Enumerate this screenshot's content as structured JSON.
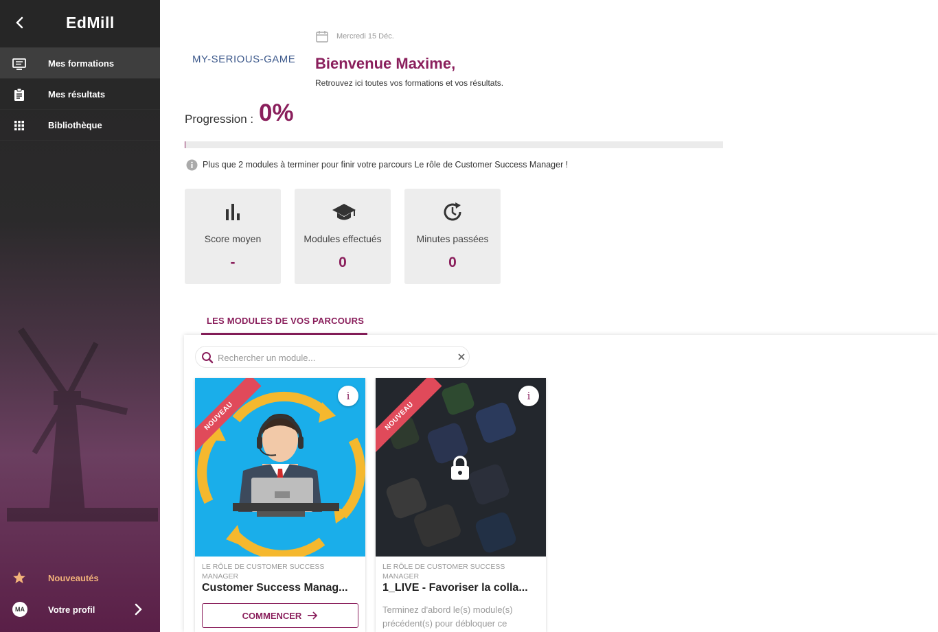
{
  "app": {
    "logo": "EdMill"
  },
  "sidebar": {
    "items": [
      {
        "label": "Mes formations",
        "icon": "courses-icon",
        "active": true
      },
      {
        "label": "Mes résultats",
        "icon": "clipboard-icon",
        "active": false
      },
      {
        "label": "Bibliothèque",
        "icon": "grid-icon",
        "active": false
      }
    ],
    "news_label": "Nouveautés",
    "profile_label": "Votre profil",
    "avatar_initials": "MA"
  },
  "header": {
    "brand": "MY-SERIOUS-GAME",
    "date": "Mercredi 15 Déc.",
    "welcome": "Bienvenue Maxime,",
    "subtitle": "Retrouvez ici toutes vos formations et vos résultats."
  },
  "progress": {
    "label": "Progression :",
    "value": "0%",
    "fraction": 0,
    "info": "Plus que 2 modules à terminer pour finir votre parcours Le rôle de Customer Success Manager !"
  },
  "stats": [
    {
      "icon": "bar-chart-icon",
      "label": "Score moyen",
      "value": "-"
    },
    {
      "icon": "graduation-cap-icon",
      "label": "Modules effectués",
      "value": "0"
    },
    {
      "icon": "clock-history-icon",
      "label": "Minutes passées",
      "value": "0"
    }
  ],
  "tab": {
    "label": "LES MODULES DE VOS PARCOURS"
  },
  "search": {
    "placeholder": "Rechercher un module...",
    "value": ""
  },
  "modules": [
    {
      "badge": "NOUVEAU",
      "category": "LE RÔLE DE CUSTOMER SUCCESS MANAGER",
      "title": "Customer Success Manag...",
      "button": "COMMENCER",
      "locked": false
    },
    {
      "badge": "NOUVEAU",
      "category": "LE RÔLE DE CUSTOMER SUCCESS MANAGER",
      "title": "1_LIVE - Favoriser la colla...",
      "description": "Terminez d'abord le(s) module(s) précédent(s) pour débloquer ce",
      "locked": true
    }
  ],
  "colors": {
    "accent": "#8a1f5c",
    "ribbon": "#e04a5a",
    "news": "#f3b37a",
    "thumb_blue": "#1aaeea"
  }
}
